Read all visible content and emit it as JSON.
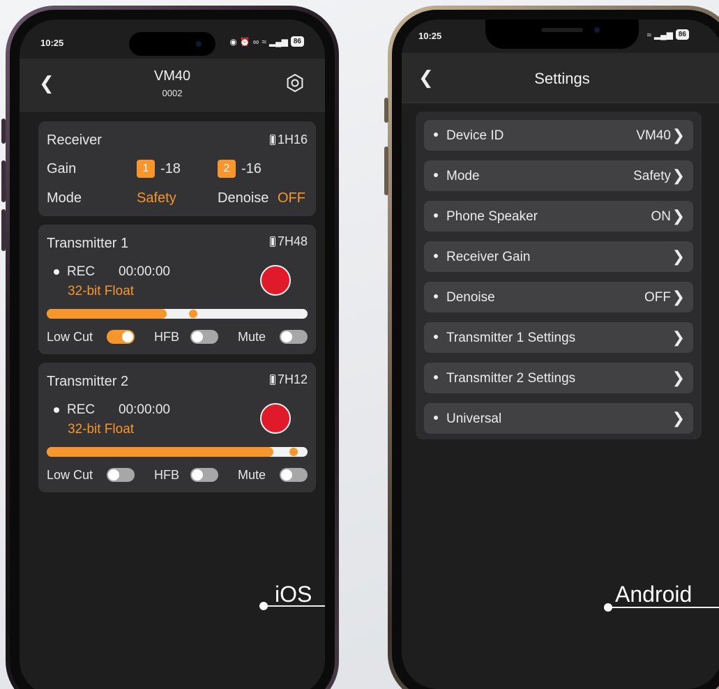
{
  "ios": {
    "status": {
      "time": "10:25",
      "battery": "86"
    },
    "header": {
      "title": "VM40",
      "subtitle": "0002"
    },
    "receiver": {
      "title": "Receiver",
      "battery": "1H16",
      "gain_label": "Gain",
      "gain1_badge": "1",
      "gain1_value": "-18",
      "gain2_badge": "2",
      "gain2_value": "-16",
      "mode_label": "Mode",
      "mode_value": "Safety",
      "denoise_label": "Denoise",
      "denoise_value": "OFF"
    },
    "transmitters": [
      {
        "title": "Transmitter 1",
        "battery": "7H48",
        "rec_label": "REC",
        "timer": "00:00:00",
        "format": "32-bit Float",
        "level": 0.46,
        "low_cut_label": "Low Cut",
        "low_cut": true,
        "hfb_label": "HFB",
        "hfb": false,
        "mute_label": "Mute",
        "mute": false
      },
      {
        "title": "Transmitter 2",
        "battery": "7H12",
        "rec_label": "REC",
        "timer": "00:00:00",
        "format": "32-bit Float",
        "level": 0.87,
        "low_cut_label": "Low Cut",
        "low_cut": false,
        "hfb_label": "HFB",
        "hfb": false,
        "mute_label": "Mute",
        "mute": false
      }
    ],
    "platform_label": "iOS"
  },
  "android": {
    "status": {
      "time": "10:25",
      "battery": "86"
    },
    "header": {
      "title": "Settings"
    },
    "settings": [
      {
        "name": "Device ID",
        "value": "VM40"
      },
      {
        "name": "Mode",
        "value": "Safety"
      },
      {
        "name": "Phone Speaker",
        "value": "ON"
      },
      {
        "name": "Receiver Gain",
        "value": ""
      },
      {
        "name": "Denoise",
        "value": "OFF"
      },
      {
        "name": "Transmitter 1 Settings",
        "value": ""
      },
      {
        "name": "Transmitter 2 Settings",
        "value": ""
      },
      {
        "name": "Universal",
        "value": ""
      }
    ],
    "platform_label": "Android"
  },
  "colors": {
    "accent": "#f6962c",
    "record": "#e0192b",
    "card": "#333335",
    "screen": "#1e1e1f"
  }
}
